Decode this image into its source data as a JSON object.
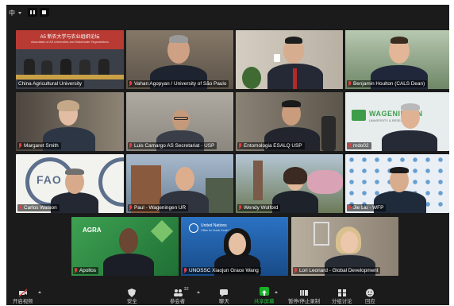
{
  "topbar": {
    "language": "中"
  },
  "participants": [
    {
      "name": "China Agricultural University",
      "screen": {
        "title": "A5 新农大学与农业组织论坛",
        "subtitle": "Association of AS Universities and Stakeholder Organizations"
      }
    },
    {
      "name": "Vahan Agopyan / University of São Paulo"
    },
    {
      "name": ""
    },
    {
      "name": "Benjamin Houlton (CALS Dean)"
    },
    {
      "name": "Margaret Smith"
    },
    {
      "name": "Luis Camargo AS Secretariat - USP"
    },
    {
      "name": "Entomologia ESALQ USP"
    },
    {
      "name": "mdo02",
      "background": {
        "brand": "WAGENINGEN",
        "tagline": "UNIVERSITY & RESEARCH"
      }
    },
    {
      "name": "Carlos Watson",
      "background": {
        "logo": "FAO"
      }
    },
    {
      "name": "Paul - Wageningen UR"
    },
    {
      "name": "Wendy Wolford"
    },
    {
      "name": "Jie Liu - WFP"
    },
    {
      "name": "Apollos",
      "background": {
        "logo": "AGRA"
      }
    },
    {
      "name": "UNOSSC Xiaojun Grace Wang",
      "background": {
        "logo": "United Nations",
        "caption": "Office for South-South Cooperation"
      }
    },
    {
      "name": "Lori Leonard - Global Development"
    }
  ],
  "toolbar": {
    "mute_label": "开启视频",
    "security_label": "安全",
    "participants_label": "参会者",
    "participants_count": "32",
    "chat_label": "聊天",
    "share_label": "共享屏幕",
    "record_label": "暂停/停止录制",
    "breakout_label": "分组讨论",
    "reactions_label": "回应"
  }
}
